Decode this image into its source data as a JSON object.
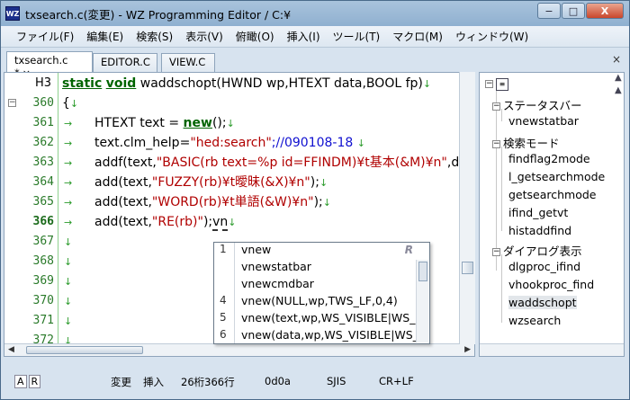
{
  "window": {
    "title": "txsearch.c(変更) - WZ Programming Editor / C:¥",
    "app_icon_text": "WZ",
    "buttons": {
      "minimize": "−",
      "maximize": "□",
      "close": "X"
    }
  },
  "menubar": [
    "ファイル(F)",
    "編集(E)",
    "検索(S)",
    "表示(V)",
    "俯瞰(O)",
    "挿入(I)",
    "ツール(T)",
    "マクロ(M)",
    "ウィンドウ(W)"
  ],
  "tabs": [
    {
      "label": "txsearch.c *",
      "close": "×",
      "active": true
    },
    {
      "label": "EDITOR.C",
      "active": false
    },
    {
      "label": "VIEW.C",
      "active": false
    }
  ],
  "editor": {
    "header_label": "H3",
    "header_code": "waddschopt(HWND wp,HTEXT data,BOOL fp)",
    "header_kw1": "static",
    "header_kw2": "void",
    "fold_minus": "−",
    "tab_glyph": "→",
    "newline_glyph": "↓",
    "lines": [
      {
        "no": "360",
        "text": "{"
      },
      {
        "no": "361",
        "pre": "HTEXT text = ",
        "kw": "new",
        "post": "();"
      },
      {
        "no": "362",
        "pre": "text.clm_help=",
        "str": "\"hed:search\"",
        "cmt": ";//090108-18"
      },
      {
        "no": "363",
        "pre": "addf(text,",
        "str": "\"BASIC(rb text=%p id=FFINDM)¥t基本(&M)¥n\"",
        "post": ",d"
      },
      {
        "no": "364",
        "pre": "add(text,",
        "str": "\"FUZZY(rb)¥t曖昧(&X)¥n\"",
        "post": ");"
      },
      {
        "no": "365",
        "pre": "add(text,",
        "str": "\"WORD(rb)¥t単語(&W)¥n\"",
        "post": ");"
      },
      {
        "no": "366",
        "pre": "add(text,",
        "str": "\"RE(rb)\"",
        "post": ");",
        "typed": "vn"
      },
      {
        "no": "367"
      },
      {
        "no": "368"
      },
      {
        "no": "369"
      },
      {
        "no": "370"
      },
      {
        "no": "371"
      },
      {
        "no": "372"
      }
    ]
  },
  "completion": {
    "items": [
      {
        "num": "1",
        "text": "vnew"
      },
      {
        "num": "",
        "text": "vnewstatbar"
      },
      {
        "num": "",
        "text": "vnewcmdbar"
      },
      {
        "num": "4",
        "text": "vnew(NULL,wp,TWS_LF,0,4)"
      },
      {
        "num": "5",
        "text": "vnew(text,wp,WS_VISIBLE|WS_"
      },
      {
        "num": "6",
        "text": "vnew(data,wp,WS_VISIBLE|WS_"
      }
    ],
    "mode_badge": "R"
  },
  "outline": {
    "close": "×",
    "nodes": [
      {
        "label": "ステータスバー",
        "level": 0,
        "expander": "−"
      },
      {
        "label": "vnewstatbar",
        "level": 1
      },
      {
        "label": "検索モード",
        "level": 0,
        "expander": "−"
      },
      {
        "label": "findflag2mode",
        "level": 1
      },
      {
        "label": "l_getsearchmode",
        "level": 1
      },
      {
        "label": "getsearchmode",
        "level": 1
      },
      {
        "label": "ifind_getvt",
        "level": 1
      },
      {
        "label": "histaddfind",
        "level": 1
      },
      {
        "label": "ダイアログ表示",
        "level": 0,
        "expander": "−"
      },
      {
        "label": "dlgproc_ifind",
        "level": 1
      },
      {
        "label": "vhookproc_find",
        "level": 1
      },
      {
        "label": "waddschopt",
        "level": 1,
        "selected": true
      },
      {
        "label": "wzsearch",
        "level": 1
      }
    ],
    "root_expander": "−"
  },
  "statusbar": {
    "mode_a": "A",
    "mode_r": "R",
    "modified": "変更",
    "insert": "挿入",
    "position": "26桁366行",
    "code": "0d0a",
    "encoding": "SJIS",
    "eol": "CR+LF"
  }
}
